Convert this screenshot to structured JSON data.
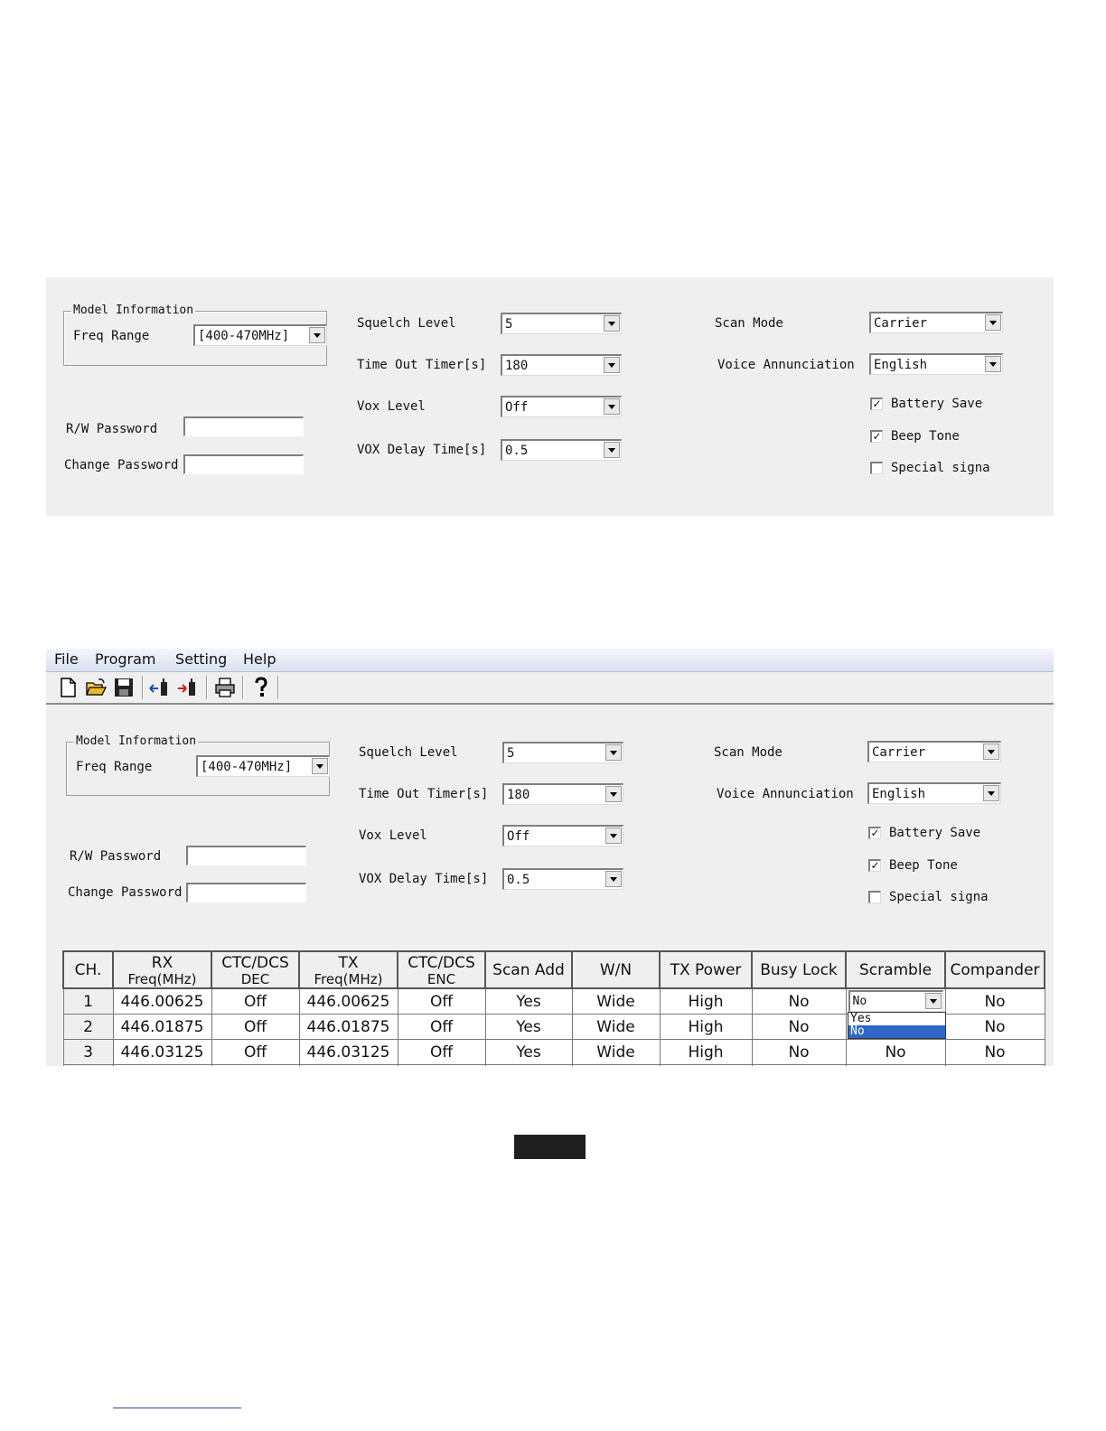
{
  "settings": {
    "model_info": "Model Information",
    "freq_range_label": "Freq Range",
    "freq_range_value": "[400-470MHz]",
    "rw_password_label": "R/W Password",
    "change_password_label": "Change Password",
    "squelch_level_label": "Squelch Level",
    "squelch_level_value": "5",
    "time_out_timer_label": "Time Out Timer[s]",
    "time_out_timer_value": "180",
    "vox_level_label": "Vox Level",
    "vox_level_value": "Off",
    "vox_delay_label": "VOX Delay Time[s]",
    "vox_delay_value": "0.5",
    "scan_mode_label": "Scan Mode",
    "scan_mode_value": "Carrier",
    "voice_label": "Voice Annunciation",
    "voice_value": "English",
    "battery_save_label": "Battery Save",
    "battery_save_checked": true,
    "beep_tone_label": "Beep Tone",
    "beep_tone_checked": true,
    "special_signal_label": "Special signa",
    "special_signal_checked": false
  },
  "menu": {
    "file": "File",
    "program": "Program",
    "setting": "Setting",
    "help": "Help"
  },
  "toolbar": {
    "icons": [
      "new-file-icon",
      "open-folder-icon",
      "save-icon",
      "read-from-radio-icon",
      "write-to-radio-icon",
      "print-icon",
      "help-icon"
    ]
  },
  "grid": {
    "headers": {
      "ch": "CH.",
      "rx_1": "RX",
      "rx_2": "Freq(MHz)",
      "ctc_dec_1": "CTC/DCS",
      "ctc_dec_2": "DEC",
      "tx_1": "TX",
      "tx_2": "Freq(MHz)",
      "ctc_enc_1": "CTC/DCS",
      "ctc_enc_2": "ENC",
      "scan_add": "Scan Add",
      "wn": "W/N",
      "tx_power": "TX Power",
      "busy_lock": "Busy Lock",
      "scramble": "Scramble",
      "compander": "Compander"
    },
    "rows": [
      {
        "ch": "1",
        "rx": "446.00625",
        "dec": "Off",
        "tx": "446.00625",
        "enc": "Off",
        "scan": "Yes",
        "wn": "Wide",
        "power": "High",
        "busy": "No",
        "scramble": "No",
        "compander": "No"
      },
      {
        "ch": "2",
        "rx": "446.01875",
        "dec": "Off",
        "tx": "446.01875",
        "enc": "Off",
        "scan": "Yes",
        "wn": "Wide",
        "power": "High",
        "busy": "No",
        "scramble": "",
        "compander": "No"
      },
      {
        "ch": "3",
        "rx": "446.03125",
        "dec": "Off",
        "tx": "446.03125",
        "enc": "Off",
        "scan": "Yes",
        "wn": "Wide",
        "power": "High",
        "busy": "No",
        "scramble": "No",
        "compander": "No"
      }
    ],
    "scramble_dropdown": {
      "options": [
        "Yes",
        "No"
      ],
      "selected": "No"
    }
  },
  "colors": {
    "panel_bg": "#efefef",
    "selection": "#3166c8",
    "menubar": "#dde3f0"
  }
}
